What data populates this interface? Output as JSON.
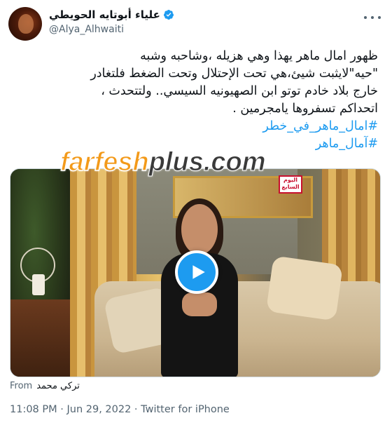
{
  "user": {
    "display_name": "علياء أبوتايه الحويطي",
    "handle": "@Alya_Alhwaiti",
    "verified": true
  },
  "tweet": {
    "lines": [
      "ظهور امال ماهر يهذا وهي هزيله ،وشاحبه وشبه",
      "\"حيه\"لايثبت شيئ،هي تحت الإحتلال  وتحت  الضغط فلتغادر",
      "خارج بلاد خادم توتو  ابن الصهيونيه السيسي.. ولتتحدث ،",
      "اتحداكم تسفروها يامجرمين ."
    ],
    "hashtags": [
      "#امال_ماهر_في_خطر",
      "#آمال_ماهر"
    ]
  },
  "media": {
    "type": "video",
    "watermark_main": "farfesh",
    "watermark_sub": "plus.com",
    "channel_logo_text": "اليوم السابع"
  },
  "from": {
    "label": "From",
    "name": "تركي محمد"
  },
  "meta": {
    "time": "11:08 PM",
    "date": "Jun 29, 2022",
    "source": "Twitter for iPhone",
    "separator": " · "
  },
  "colors": {
    "accent": "#1d9bf0",
    "text": "#0f1419",
    "muted": "#536471",
    "watermark": "#f39a1a"
  },
  "icons": [
    "verified-badge-icon",
    "more-icon",
    "play-icon"
  ]
}
